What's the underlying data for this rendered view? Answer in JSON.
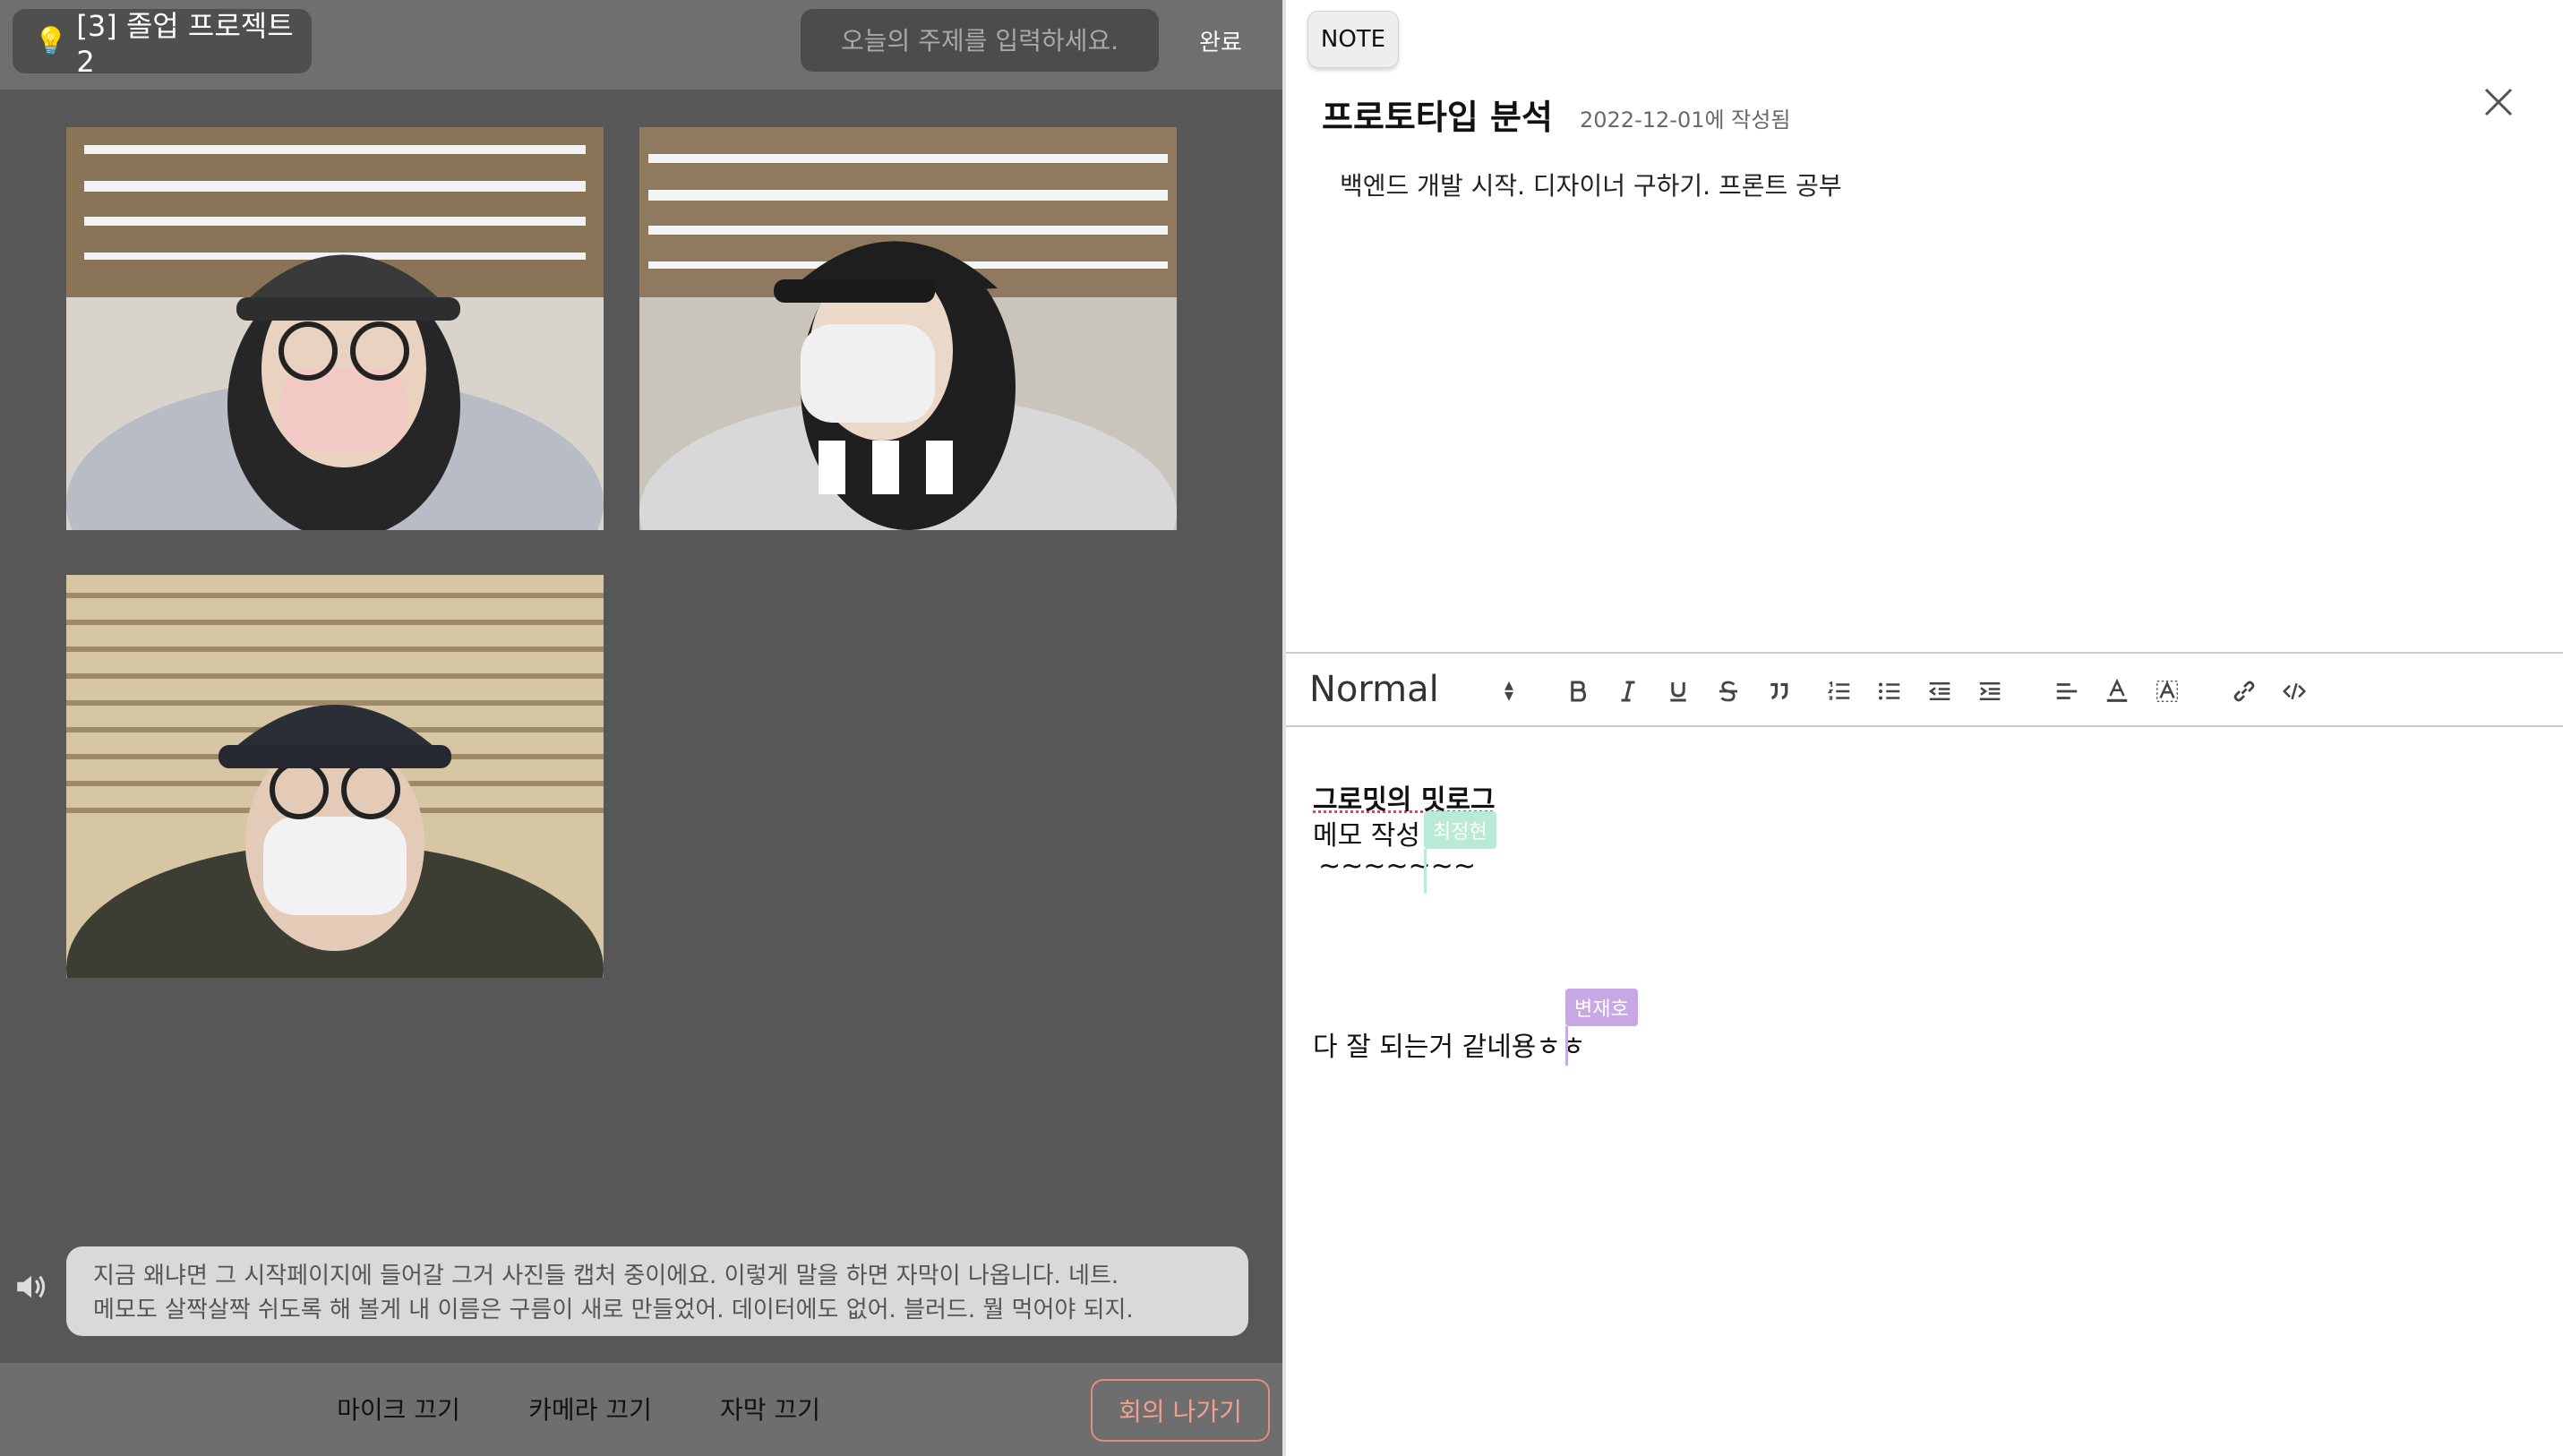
{
  "room": {
    "title": "[3] 졸업 프로젝트2",
    "icon": "lightbulb-icon"
  },
  "topic": {
    "placeholder": "오늘의 주제를 입력하세요.",
    "done_label": "완료"
  },
  "videos": [
    {
      "name": "participant-video-1"
    },
    {
      "name": "participant-video-2"
    },
    {
      "name": "participant-video-3"
    }
  ],
  "caption": {
    "line1": "지금 왜냐면 그 시작페이지에 들어갈 그거 사진들 캡처 중이에요. 이렇게 말을 하면 자막이 나옵니다. 네트.",
    "line2": "메모도 살짝살짝 쉬도록 해 볼게 내 이름은 구름이 새로 만들었어. 데이터에도 없어. 블러드. 뭘 먹어야 되지."
  },
  "controls": {
    "mic_label": "마이크 끄기",
    "camera_label": "카메라 끄기",
    "subtitle_label": "자막 끄기",
    "leave_label": "회의 나가기"
  },
  "note": {
    "tab_label": "NOTE",
    "title": "프로토타입 분석",
    "date": "2022-12-01에 작성됨",
    "summary": "백엔드 개발 시작. 디자이너 구하기. 프론트 공부"
  },
  "editor": {
    "format": "Normal",
    "heading": "그로밋의 밋로그",
    "memo": "메모 작성",
    "tilde": "~~~~~~~",
    "final": "다 잘 되는거 같네용ㅎㅎ",
    "cursor_green_name": "최정현",
    "cursor_purple_name": "변재호"
  },
  "colors": {
    "accent_leave": "#e28f7a",
    "cursor_green": "#b8ead5",
    "cursor_purple": "#c7a7e4"
  }
}
